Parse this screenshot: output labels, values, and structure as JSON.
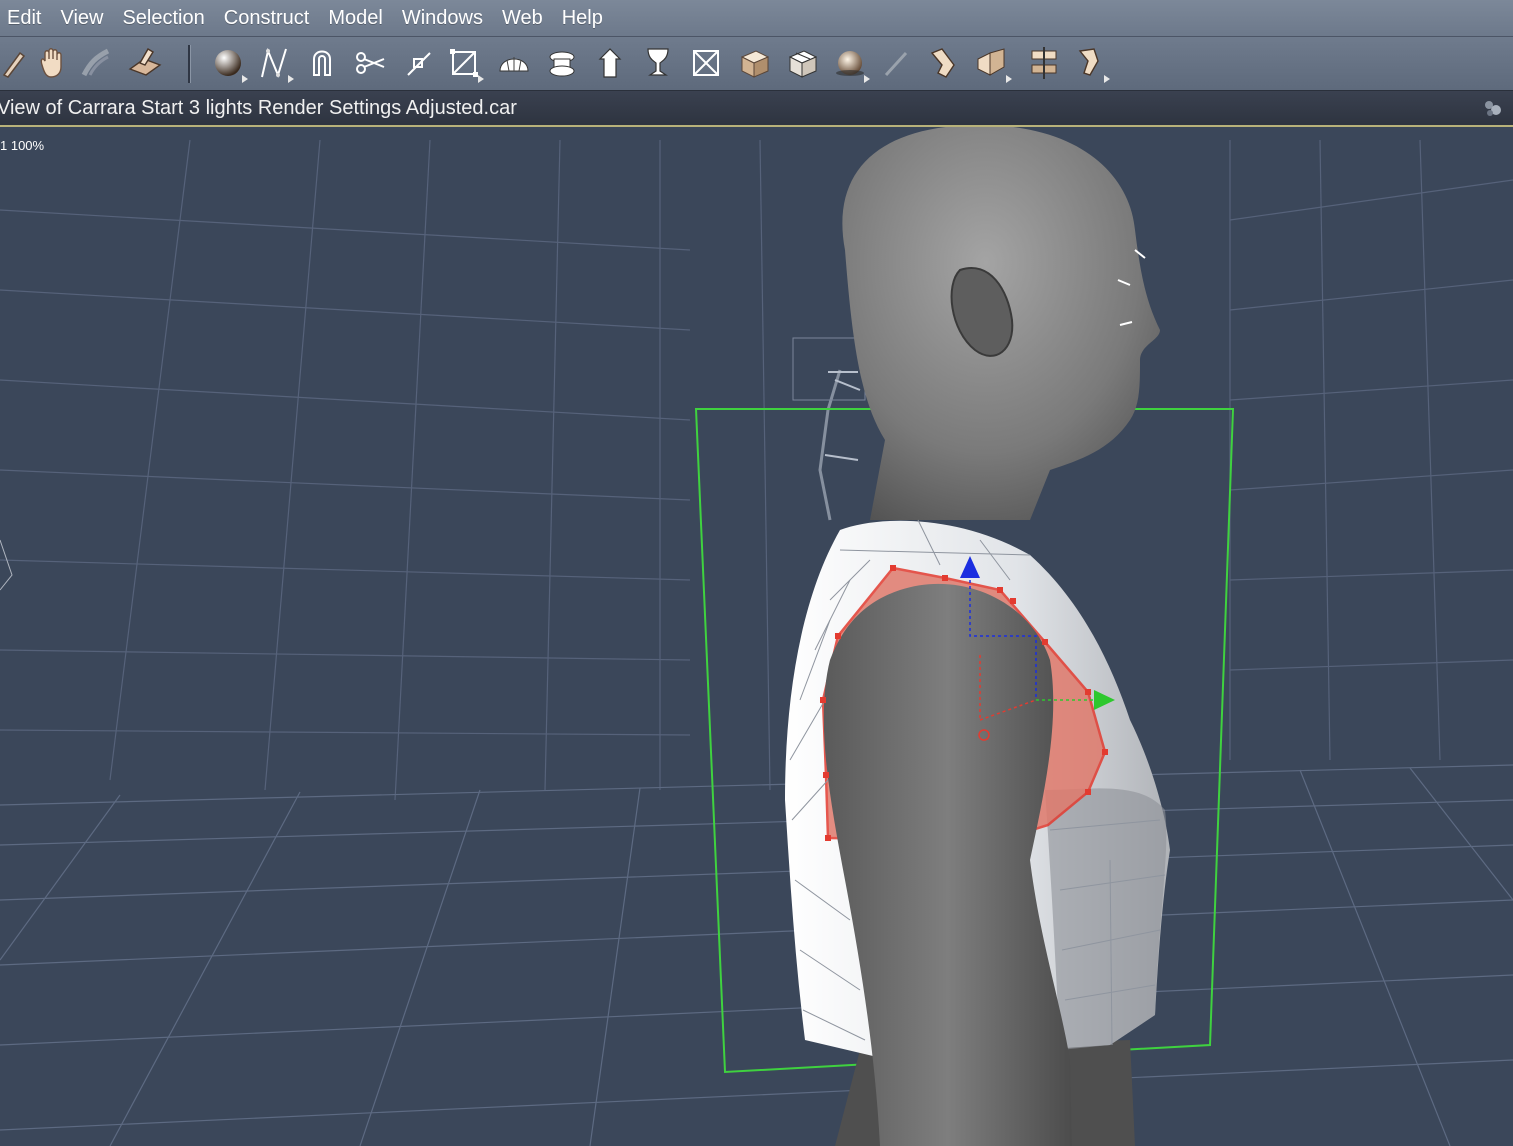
{
  "menu": {
    "items": [
      "Edit",
      "View",
      "Selection",
      "Construct",
      "Model",
      "Windows",
      "Web",
      "Help"
    ]
  },
  "toolbar": {
    "tools": [
      "eyedropper-icon",
      "hand-pan-icon",
      "bend-icon",
      "tilt-icon",
      "sphere-icon",
      "spline-icon",
      "magnet-icon",
      "scissors-icon",
      "knife-icon",
      "bounding-box-icon",
      "half-dome-icon",
      "extrude-icon",
      "arrow-icon",
      "vase-icon",
      "square-x-icon",
      "cube-icon",
      "box-open-icon",
      "ball-icon",
      "pen-icon",
      "pose-icon",
      "deform-icon",
      "align-icon",
      "paint-icon"
    ]
  },
  "view": {
    "title": "View of Carrara Start 3 lights Render Settings Adjusted.car",
    "zoom": "1 100%"
  },
  "colors": {
    "background": "#3b475a",
    "selection_box": "#3fd23f",
    "selected_edges": "#e33b30",
    "axis_x": "#2ec82e",
    "axis_y": "#1b2ee0",
    "axis_z": "#e33b30"
  }
}
